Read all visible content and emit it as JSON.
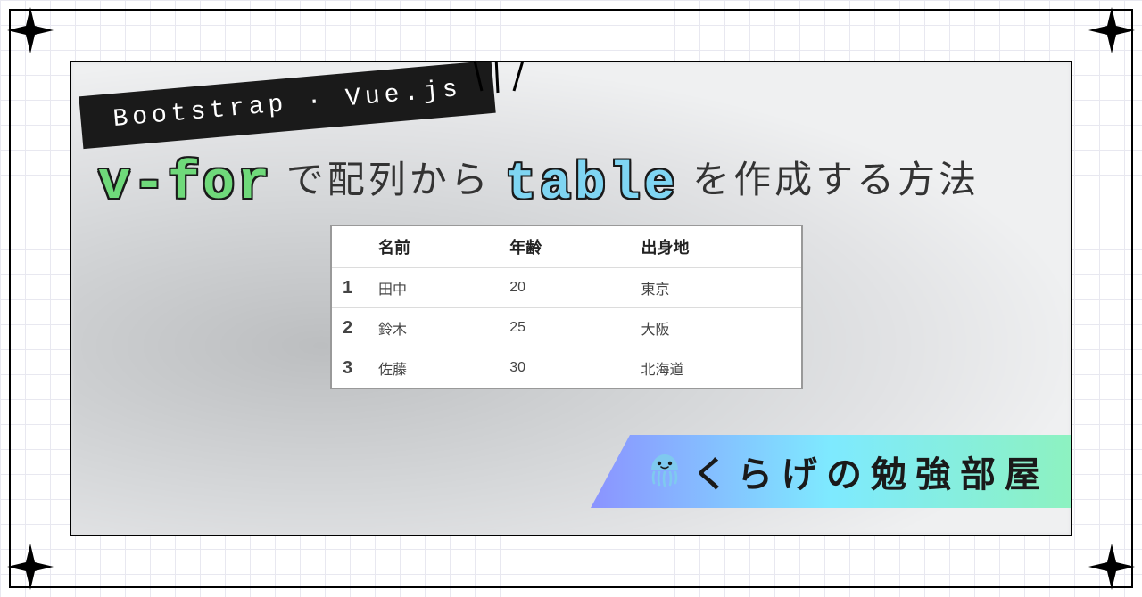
{
  "category_label": "Bootstrap · Vue.js",
  "title": {
    "keyword1": "v-for",
    "mid1": " で配列から ",
    "keyword2": "table",
    "mid2": " を作成する方法"
  },
  "sample_table": {
    "head": {
      "col_index": "",
      "col_name": "名前",
      "col_age": "年齢",
      "col_origin": "出身地"
    },
    "rows": [
      {
        "idx": "1",
        "name": "田中",
        "age": "20",
        "origin": "東京"
      },
      {
        "idx": "2",
        "name": "鈴木",
        "age": "25",
        "origin": "大阪"
      },
      {
        "idx": "3",
        "name": "佐藤",
        "age": "30",
        "origin": "北海道"
      }
    ]
  },
  "site_name": "くらげの勉強部屋",
  "icons": {
    "jellyfish": "jellyfish-icon"
  },
  "colors": {
    "keyword_green": "#6fd97a",
    "keyword_blue": "#7fd5f2",
    "ribbon_gradient_from": "#8b93ff",
    "ribbon_gradient_mid": "#7eeaff",
    "ribbon_gradient_to": "#8df2c0",
    "label_bg": "#1a1a1a"
  }
}
